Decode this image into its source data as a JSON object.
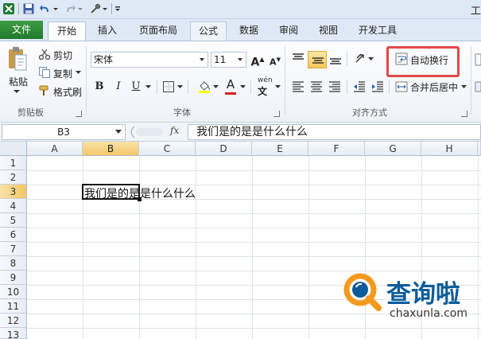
{
  "ribbon_tabs": [
    {
      "label": "文件"
    },
    {
      "label": "开始"
    },
    {
      "label": "插入"
    },
    {
      "label": "页面布局"
    },
    {
      "label": "公式"
    },
    {
      "label": "数据"
    },
    {
      "label": "审阅"
    },
    {
      "label": "视图"
    },
    {
      "label": "开发工具"
    }
  ],
  "window_title_partial": "工",
  "clipboard": {
    "paste": "粘贴",
    "cut": "剪切",
    "copy": "复制",
    "format_painter": "格式刷",
    "group_label": "剪贴板"
  },
  "font": {
    "font_name": "宋体",
    "font_size": "11",
    "bold": "B",
    "italic": "I",
    "underline": "U",
    "increase_size": "A",
    "decrease_size": "A",
    "wen": "wén",
    "font_color_letter": "A",
    "group_label": "字体"
  },
  "alignment": {
    "wrap_text": "自动换行",
    "merge_center": "合并后居中",
    "group_label": "对齐方式"
  },
  "formula_bar": {
    "name_box": "B3",
    "fx": "fx",
    "formula": "我们是的是是什么什么"
  },
  "grid": {
    "columns": [
      "A",
      "B",
      "C",
      "D",
      "E",
      "F",
      "G",
      "H"
    ],
    "rows": [
      "1",
      "2",
      "3",
      "4",
      "5",
      "6",
      "7",
      "8",
      "9",
      "10",
      "11",
      "12",
      "13"
    ],
    "selected_cell": "B3",
    "cell_b3": "我们是的是是什么什么"
  },
  "watermark": {
    "brand": "查询啦",
    "domain": "chaxunla.com"
  },
  "colors": {
    "file_tab": "#2f7d32",
    "selection": "#f2c766",
    "highlight_box": "#e0484b",
    "watermark_blue": "#0d5b9a",
    "watermark_orange": "#f29a1f"
  }
}
